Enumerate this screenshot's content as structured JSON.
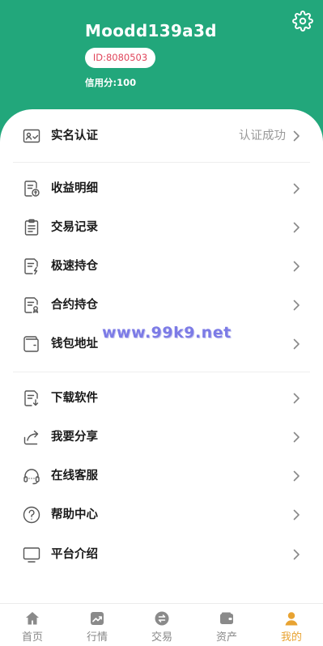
{
  "profile": {
    "username": "Moodd139a3d",
    "id_label": "ID:8080503",
    "credit": "信用分:100"
  },
  "menu": {
    "verify": {
      "label": "实名认证",
      "value": "认证成功",
      "icon": "id-card-icon"
    },
    "group1": [
      {
        "label": "收益明细",
        "icon": "income-doc-icon"
      },
      {
        "label": "交易记录",
        "icon": "clipboard-icon"
      },
      {
        "label": "极速持仓",
        "icon": "flash-doc-icon"
      },
      {
        "label": "合约持仓",
        "icon": "contract-doc-icon"
      },
      {
        "label": "钱包地址",
        "icon": "wallet-icon"
      }
    ],
    "group2": [
      {
        "label": "下载软件",
        "icon": "download-doc-icon"
      },
      {
        "label": "我要分享",
        "icon": "share-icon"
      },
      {
        "label": "在线客服",
        "icon": "headset-icon"
      },
      {
        "label": "帮助中心",
        "icon": "help-icon"
      },
      {
        "label": "平台介绍",
        "icon": "monitor-icon"
      }
    ]
  },
  "watermark": "www.99k9.net",
  "tabs": [
    {
      "label": "首页",
      "icon": "home-icon"
    },
    {
      "label": "行情",
      "icon": "chart-icon"
    },
    {
      "label": "交易",
      "icon": "exchange-icon"
    },
    {
      "label": "资产",
      "icon": "wallet-tab-icon"
    },
    {
      "label": "我的",
      "icon": "user-icon",
      "active": true
    }
  ],
  "colors": {
    "header": "#22a77b",
    "active_tab": "#e8a332",
    "id_text": "#e0445a"
  }
}
